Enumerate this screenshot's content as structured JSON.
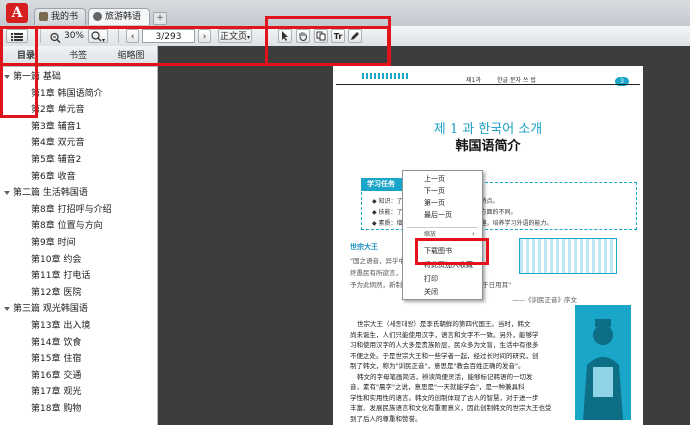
{
  "tabs": [
    {
      "label": "我的书架",
      "icon": "bookshelf-icon"
    },
    {
      "label": "旅游韩语",
      "icon": "book-icon"
    }
  ],
  "new_tab_label": "+",
  "toolbar": {
    "zoom_value": "30%",
    "page_value": "3/293",
    "view_mode": "正文页",
    "tools": [
      "select-tool-icon",
      "hand-tool-icon",
      "copy-tool-icon",
      "text-tool-icon",
      "pen-tool-icon"
    ]
  },
  "sidebar": {
    "tabs": [
      "目录",
      "书签",
      "缩略图"
    ],
    "toc": [
      {
        "type": "part",
        "label": "第一篇 基础"
      },
      {
        "type": "chap",
        "label": "第1章 韩国语简介"
      },
      {
        "type": "chap",
        "label": "第2章 单元音"
      },
      {
        "type": "chap",
        "label": "第3章 辅音1"
      },
      {
        "type": "chap",
        "label": "第4章 双元音"
      },
      {
        "type": "chap",
        "label": "第5章 辅音2"
      },
      {
        "type": "chap",
        "label": "第6章 收音"
      },
      {
        "type": "part",
        "label": "第二篇 生活韩国语"
      },
      {
        "type": "chap",
        "label": "第8章 打招呼与介绍"
      },
      {
        "type": "chap",
        "label": "第8章 位置与方向"
      },
      {
        "type": "chap",
        "label": "第9章 时间"
      },
      {
        "type": "chap",
        "label": "第10章 约会"
      },
      {
        "type": "chap",
        "label": "第11章 打电话"
      },
      {
        "type": "chap",
        "label": "第12章 医院"
      },
      {
        "type": "part",
        "label": "第三篇 观光韩国语"
      },
      {
        "type": "chap",
        "label": "第13章 出入境"
      },
      {
        "type": "chap",
        "label": "第14章 饮食"
      },
      {
        "type": "chap",
        "label": "第15章 住宿"
      },
      {
        "type": "chap",
        "label": "第16章 交通"
      },
      {
        "type": "chap",
        "label": "第17章 观光"
      },
      {
        "type": "chap",
        "label": "第18章 购物"
      }
    ]
  },
  "page": {
    "header_left": "제1과",
    "header_mid": "한글 문자 쓰 법",
    "number": "3",
    "title_ko": "제 1 과   한국어 소개",
    "title_cn": "韩国语简介",
    "goal_label": "学习任务",
    "goals": [
      "◆ 知识：了解韩国语的词汇和语法方面的特点。",
      "◆ 技能：了解韩国语与汉语在词汇和语法方面的不同。",
      "◆ 素质：增强学习者对韩国语的了解和兴趣，培养学习外语的能力。"
    ],
    "quote_label": "世宗大王",
    "quotes": [
      "\"国之语音，异乎中国，",
      "终愚民有所欲言，",
      "予为此悯然，新制二十八字，欲使人人易习 便于日用耳\""
    ],
    "quote_source": "——《训民正音》序文",
    "body": [
      "世宗大王（세종대왕）是李氏朝鲜的第四代国王。当时，韩文",
      "尚未诞生，人们只能使用汉字，语言和文字不一致。另外，能够学",
      "习和使用汉字的人大多是贵族阶层，民众多为文盲，生活中有很多",
      "不便之处。于是世宗大王和一些学者一起，经过长时间的研究，创",
      "制了韩文，称为\"训民正音\"，意思是\"教会百姓正确的发音\"。",
      "韩文的字母笔画简洁，辨读简便灵活，能够标记韩语的一切发",
      "音，素有\"晨字\"之说，意思是\"一天就能学会\"，是一种兼具科",
      "学性和实用性的语言。韩文的创制体现了古人的智慧，对于进一步",
      "丰富、发展民族语言和文化有重要意义，因此创制韩文的世宗大王也受",
      "到了后人的尊重和赞誉。"
    ]
  },
  "context_menu": {
    "items": [
      "上一页",
      "下一页",
      "第一页",
      "最后一页",
      "缩放",
      "下载图书",
      "将此页加入收藏",
      "打印",
      "关闭"
    ]
  },
  "colors": {
    "highlight": "#e0141a",
    "accent": "#1aa6c8",
    "logo": "#d62020"
  }
}
